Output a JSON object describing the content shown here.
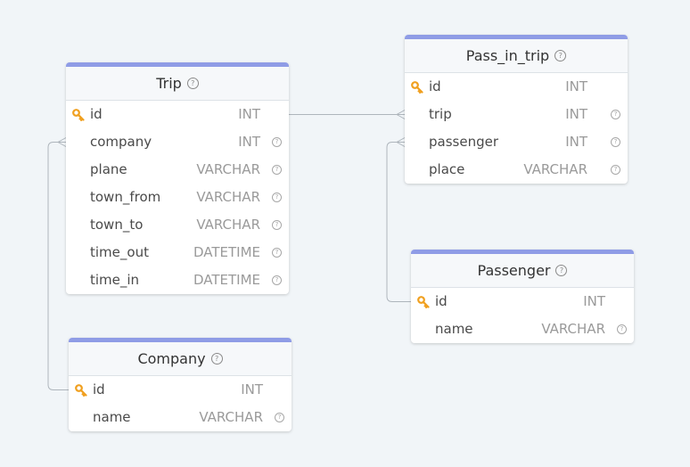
{
  "accent_color": "#8f9ce6",
  "link_color": "#aeb5bc",
  "key_color": "#f0a020",
  "icons": {
    "primary_key": "key-icon",
    "help": "question-circle-icon"
  },
  "tables": [
    {
      "name": "Trip",
      "columns": [
        {
          "name": "id",
          "type": "INT",
          "pk": true,
          "help": false
        },
        {
          "name": "company",
          "type": "INT",
          "pk": false,
          "help": true
        },
        {
          "name": "plane",
          "type": "VARCHAR",
          "pk": false,
          "help": true
        },
        {
          "name": "town_from",
          "type": "VARCHAR",
          "pk": false,
          "help": true
        },
        {
          "name": "town_to",
          "type": "VARCHAR",
          "pk": false,
          "help": true
        },
        {
          "name": "time_out",
          "type": "DATETIME",
          "pk": false,
          "help": true
        },
        {
          "name": "time_in",
          "type": "DATETIME",
          "pk": false,
          "help": true
        }
      ]
    },
    {
      "name": "Pass_in_trip",
      "columns": [
        {
          "name": "id",
          "type": "INT",
          "pk": true,
          "help": false
        },
        {
          "name": "trip",
          "type": "INT",
          "pk": false,
          "help": true
        },
        {
          "name": "passenger",
          "type": "INT",
          "pk": false,
          "help": true
        },
        {
          "name": "place",
          "type": "VARCHAR",
          "pk": false,
          "help": true
        }
      ]
    },
    {
      "name": "Passenger",
      "columns": [
        {
          "name": "id",
          "type": "INT",
          "pk": true,
          "help": false
        },
        {
          "name": "name",
          "type": "VARCHAR",
          "pk": false,
          "help": true
        }
      ]
    },
    {
      "name": "Company",
      "columns": [
        {
          "name": "id",
          "type": "INT",
          "pk": true,
          "help": false
        },
        {
          "name": "name",
          "type": "VARCHAR",
          "pk": false,
          "help": true
        }
      ]
    }
  ],
  "relations": [
    {
      "from": "Trip.id",
      "to": "Pass_in_trip.trip"
    },
    {
      "from": "Passenger.id",
      "to": "Pass_in_trip.passenger"
    },
    {
      "from": "Company.id",
      "to": "Trip.company"
    }
  ]
}
